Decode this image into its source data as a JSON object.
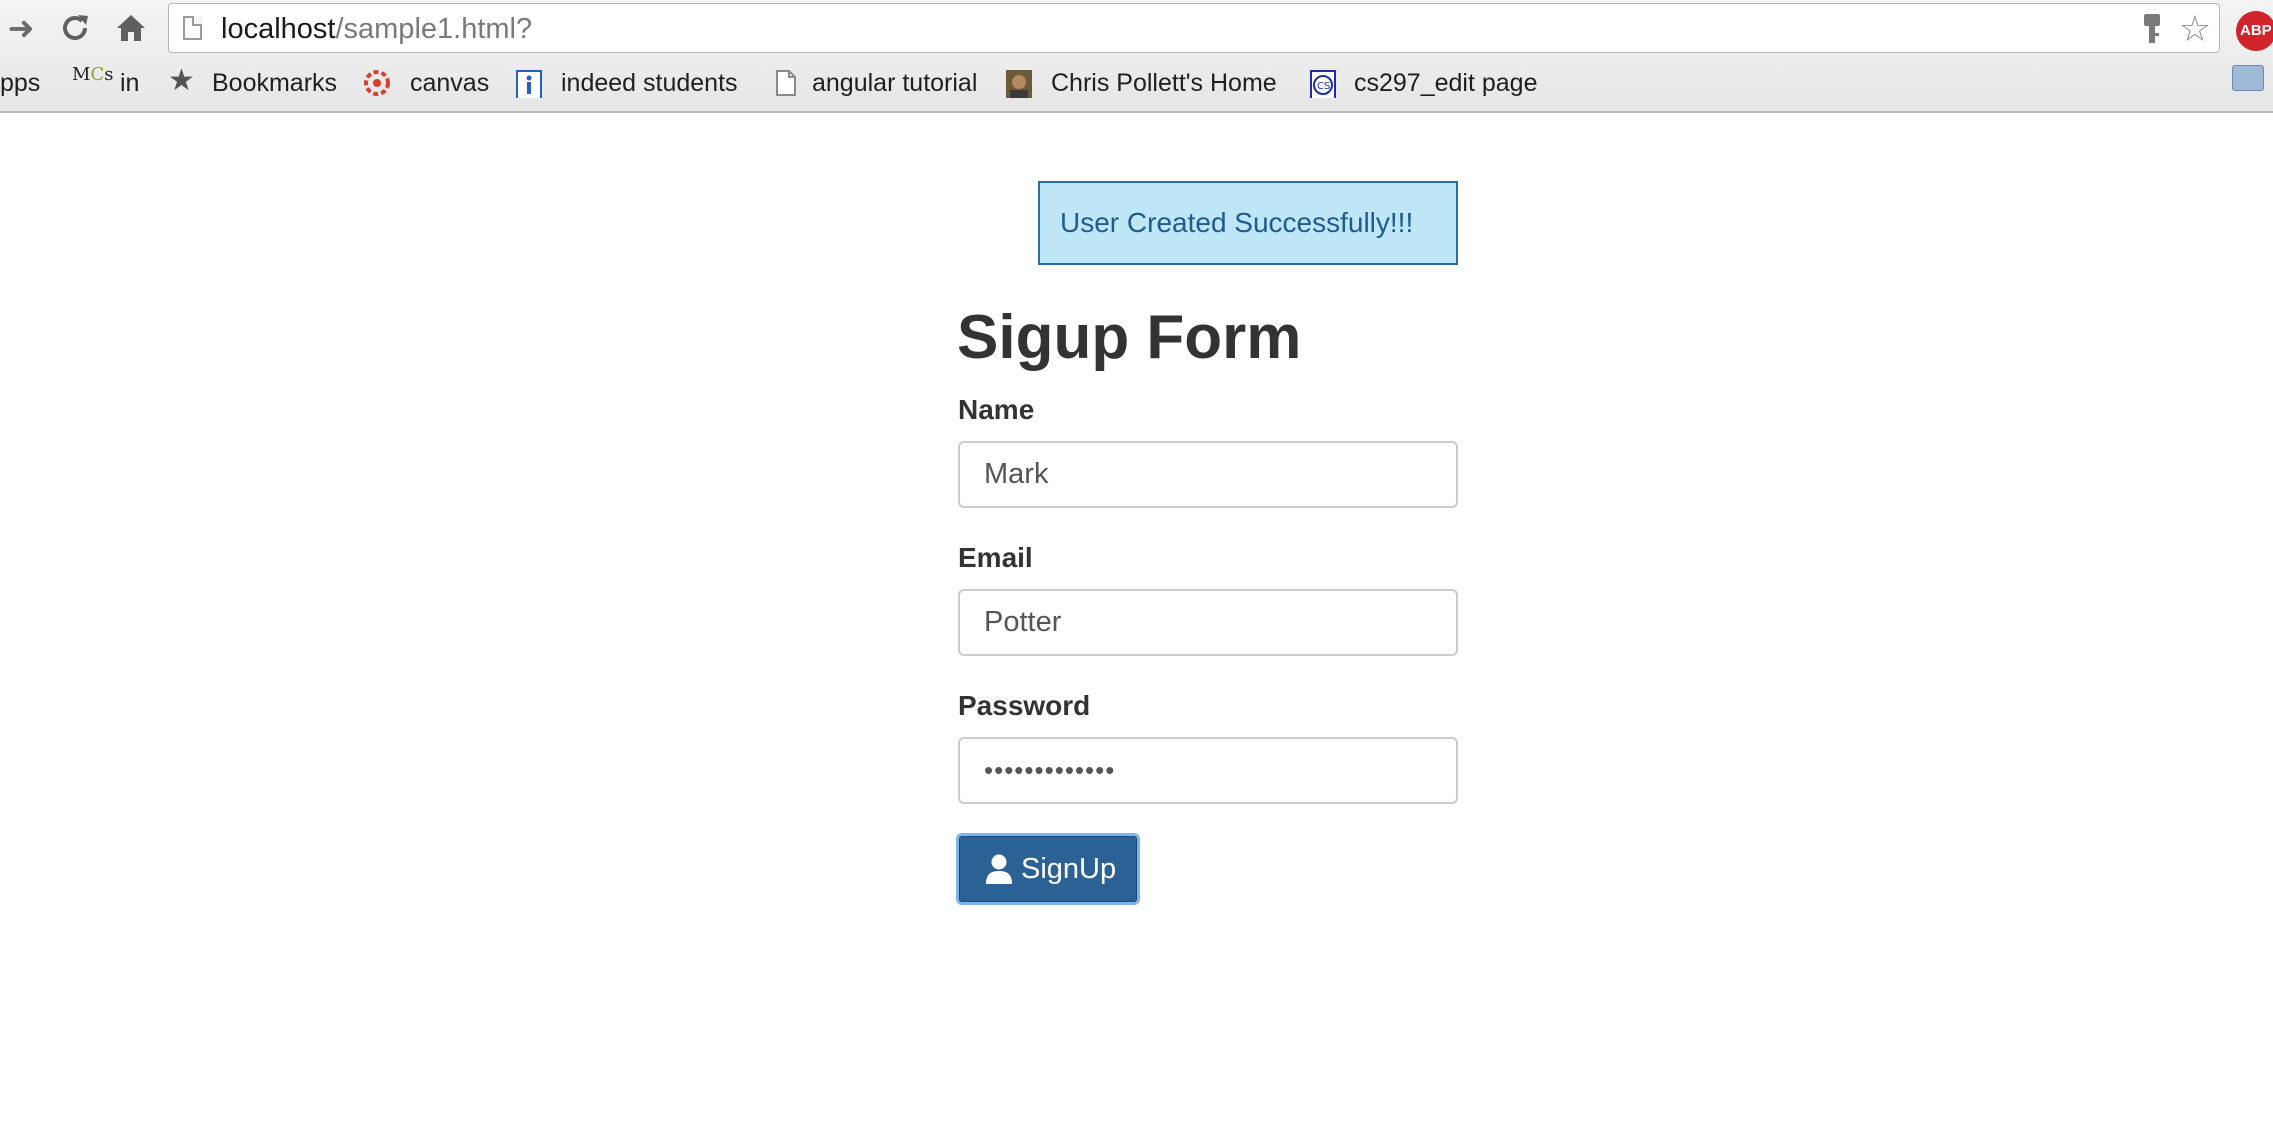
{
  "browser": {
    "url_host": "localhost",
    "url_path": "/sample1.html?",
    "abp_badge": "ABP",
    "bookmarks": [
      {
        "label": "pps",
        "icon": "apps-icon"
      },
      {
        "label": "in",
        "icon": "mcs-icon"
      },
      {
        "label": "Bookmarks",
        "icon": "star-icon"
      },
      {
        "label": "canvas",
        "icon": "canvas-icon"
      },
      {
        "label": "indeed students",
        "icon": "info-icon"
      },
      {
        "label": "angular tutorial",
        "icon": "page-icon"
      },
      {
        "label": "Chris Pollett's Home",
        "icon": "avatar-icon"
      },
      {
        "label": "cs297_edit page",
        "icon": "cs-icon"
      }
    ]
  },
  "alert": {
    "message": "User Created Successfully!!!"
  },
  "form": {
    "title": "Sigup Form",
    "name_label": "Name",
    "name_value": "Mark",
    "email_label": "Email",
    "email_value": "Potter",
    "password_label": "Password",
    "password_value": "•••••••••••••",
    "submit_label": "SignUp"
  },
  "colors": {
    "alert_bg": "#bfe6f6",
    "alert_text": "#1f5b8f",
    "button_bg": "#2b6296"
  }
}
